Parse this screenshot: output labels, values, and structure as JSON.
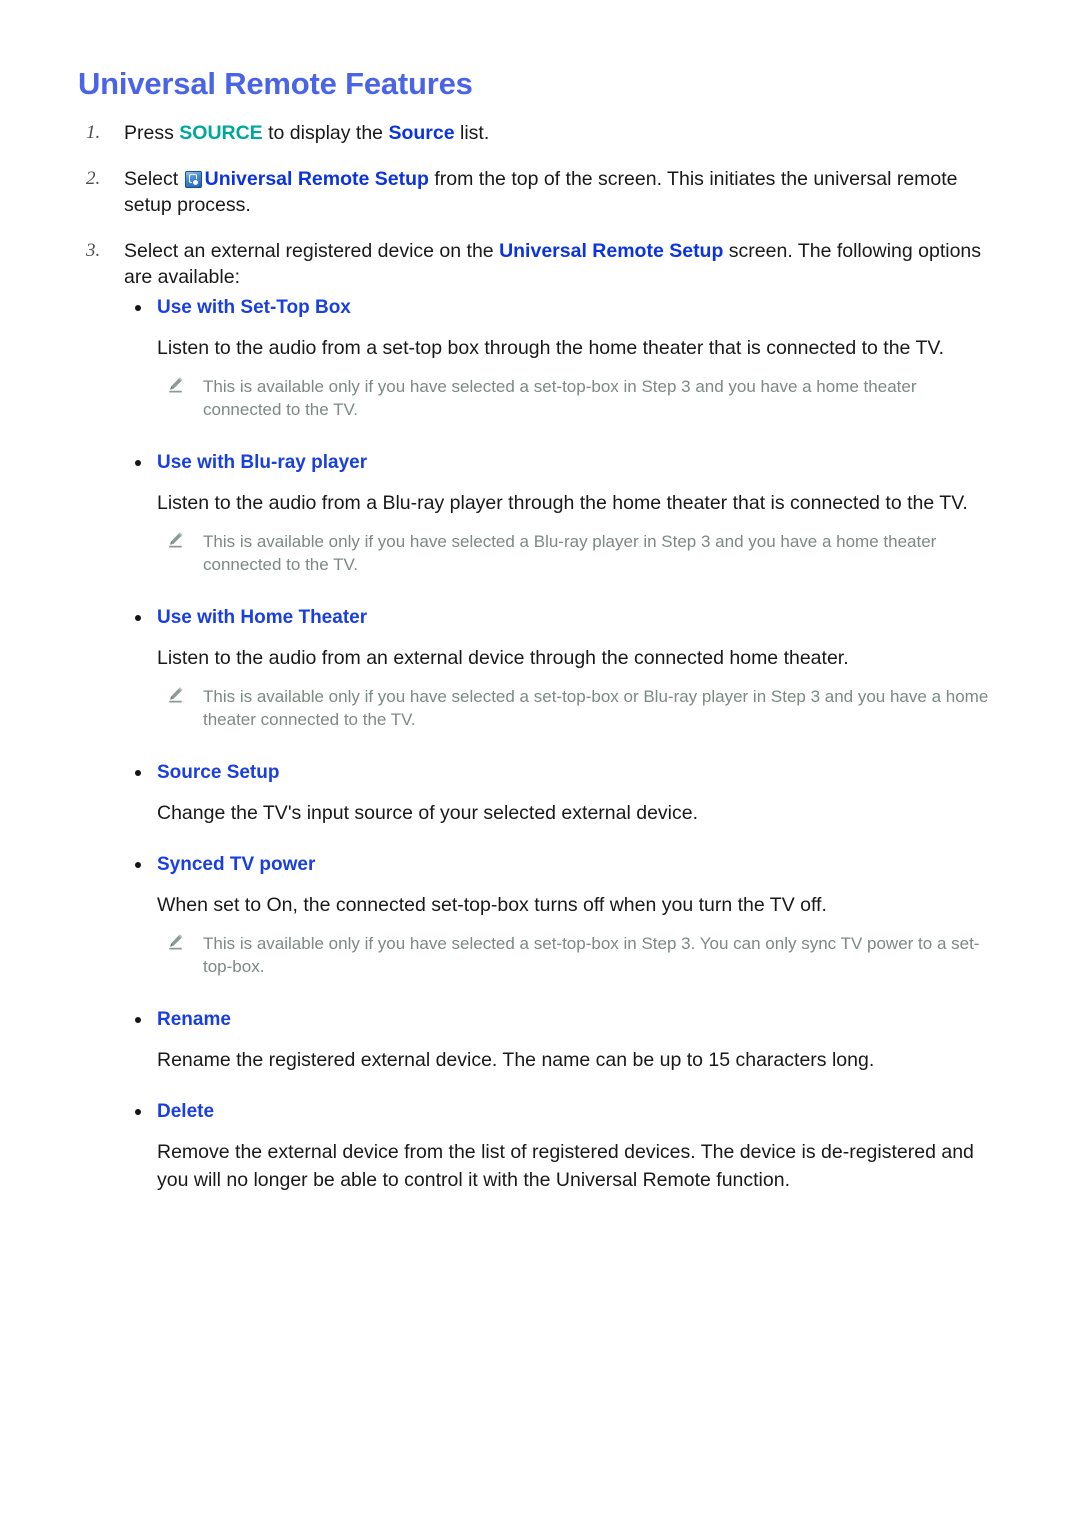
{
  "page": {
    "title": "Universal Remote Features"
  },
  "steps": [
    {
      "number": "1.",
      "prefix": "Press ",
      "kw_teal": "SOURCE",
      "middle": " to display the ",
      "kw_blue": "Source",
      "suffix": " list."
    },
    {
      "number": "2.",
      "prefix": "Select ",
      "icon": "universal-remote-setup-icon",
      "kw_blue": "Universal Remote Setup",
      "suffix": " from the top of the screen. This initiates the universal remote setup process."
    },
    {
      "number": "3.",
      "prefix": "Select an external registered device on the ",
      "kw_blue": "Universal Remote Setup",
      "suffix": " screen. The following options are available:"
    }
  ],
  "options": [
    {
      "heading": "Use with Set-Top Box",
      "body": "Listen to the audio from a set-top box through the home theater that is connected to the TV.",
      "note": "This is available only if you have selected a set-top-box in Step 3 and you have a home theater connected to the TV."
    },
    {
      "heading": "Use with Blu-ray player",
      "body": "Listen to the audio from a Blu-ray player through the home theater that is connected to the TV.",
      "note": "This is available only if you have selected a Blu-ray player in Step 3 and you have a home theater connected to the TV."
    },
    {
      "heading": "Use with Home Theater",
      "body": "Listen to the audio from an external device through the connected home theater.",
      "note": "This is available only if you have selected a set-top-box or Blu-ray player in Step 3 and you have a home theater connected to the TV."
    },
    {
      "heading": "Source Setup",
      "body": "Change the TV's input source of your selected external device.",
      "note": null
    },
    {
      "heading": "Synced TV power",
      "body": "When set to On, the connected set-top-box turns off when you turn the TV off.",
      "note": "This is available only if you have selected a set-top-box in Step 3. You can only sync TV power to a set-top-box."
    },
    {
      "heading": "Rename",
      "body": "Rename the registered external device. The name can be up to 15 characters long.",
      "note": null
    },
    {
      "heading": "Delete",
      "body": "Remove the external device from the list of registered devices. The device is de-registered and you will no longer be able to control it with the Universal Remote function.",
      "note": null
    }
  ],
  "colors": {
    "title_blue": "#4a64e8",
    "link_blue": "#0b34e0",
    "heading_blue": "#1a3fe0",
    "source_teal": "#00a79b",
    "note_gray": "#7b8a82",
    "body_black": "#191919"
  }
}
